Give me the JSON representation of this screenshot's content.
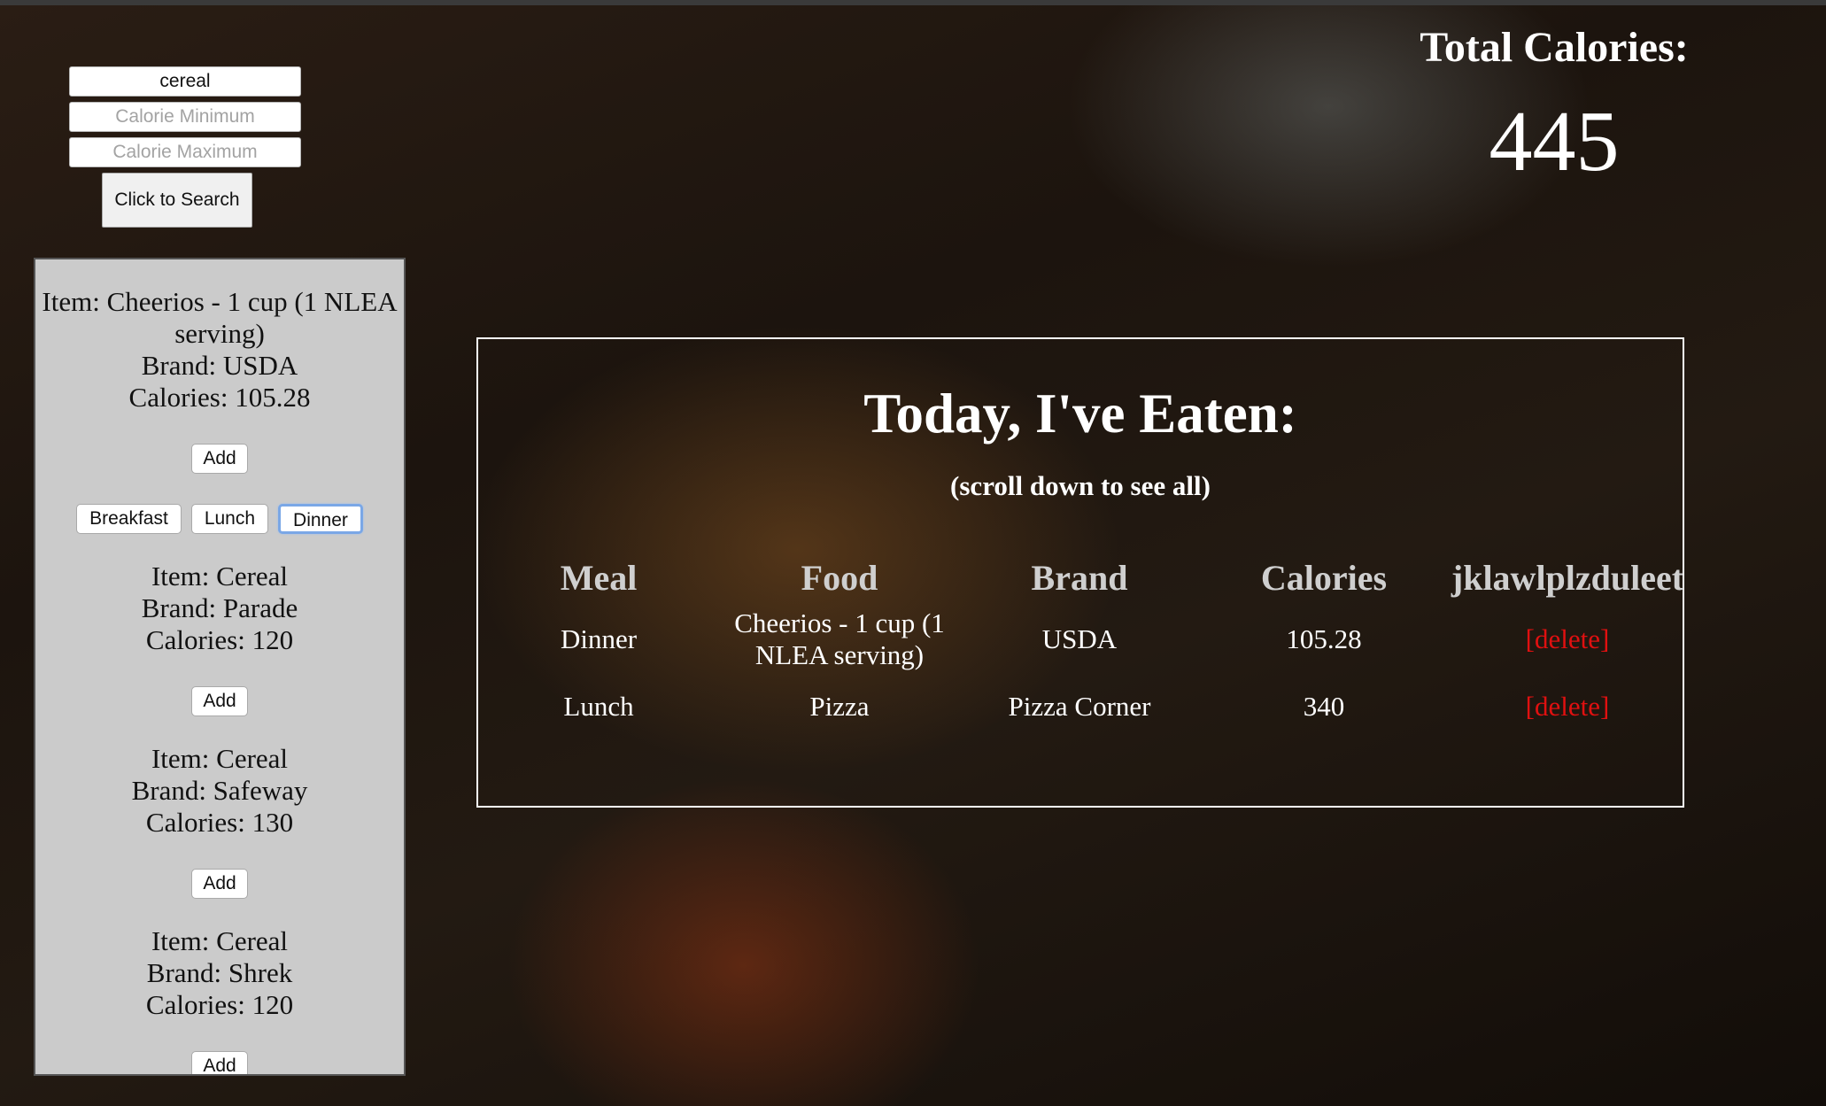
{
  "search": {
    "query_value": "cereal",
    "min_placeholder": "Calorie Minimum",
    "max_placeholder": "Calorie Maximum",
    "button_label": "Click to Search"
  },
  "results": [
    {
      "item_line": "Item: Cheerios - 1 cup (1 NLEA serving)",
      "brand_line": "Brand: USDA",
      "calories_line": "Calories: 105.28",
      "add_label": "Add",
      "meal_options": [
        "Breakfast",
        "Lunch",
        "Dinner"
      ],
      "selected_meal": "Dinner"
    },
    {
      "item_line": "Item: Cereal",
      "brand_line": "Brand: Parade",
      "calories_line": "Calories: 120",
      "add_label": "Add"
    },
    {
      "item_line": "Item: Cereal",
      "brand_line": "Brand: Safeway",
      "calories_line": "Calories: 130",
      "add_label": "Add"
    },
    {
      "item_line": "Item: Cereal",
      "brand_line": "Brand: Shrek",
      "calories_line": "Calories: 120",
      "add_label": "Add"
    }
  ],
  "total": {
    "title": "Total Calories:",
    "value": "445"
  },
  "eaten": {
    "title": "Today, I've Eaten:",
    "subtitle": "(scroll down to see all)",
    "columns": [
      "Meal",
      "Food",
      "Brand",
      "Calories",
      "jklawlplzduleet"
    ],
    "rows": [
      {
        "meal": "Dinner",
        "food": "Cheerios - 1 cup (1 NLEA serving)",
        "brand": "USDA",
        "calories": "105.28",
        "action": "[delete]"
      },
      {
        "meal": "Lunch",
        "food": "Pizza",
        "brand": "Pizza Corner",
        "calories": "340",
        "action": "[delete]"
      }
    ]
  },
  "colors": {
    "delete_link": "#e01010",
    "panel_bg": "#cbcbcb",
    "active_outline": "#7aa7e6"
  }
}
